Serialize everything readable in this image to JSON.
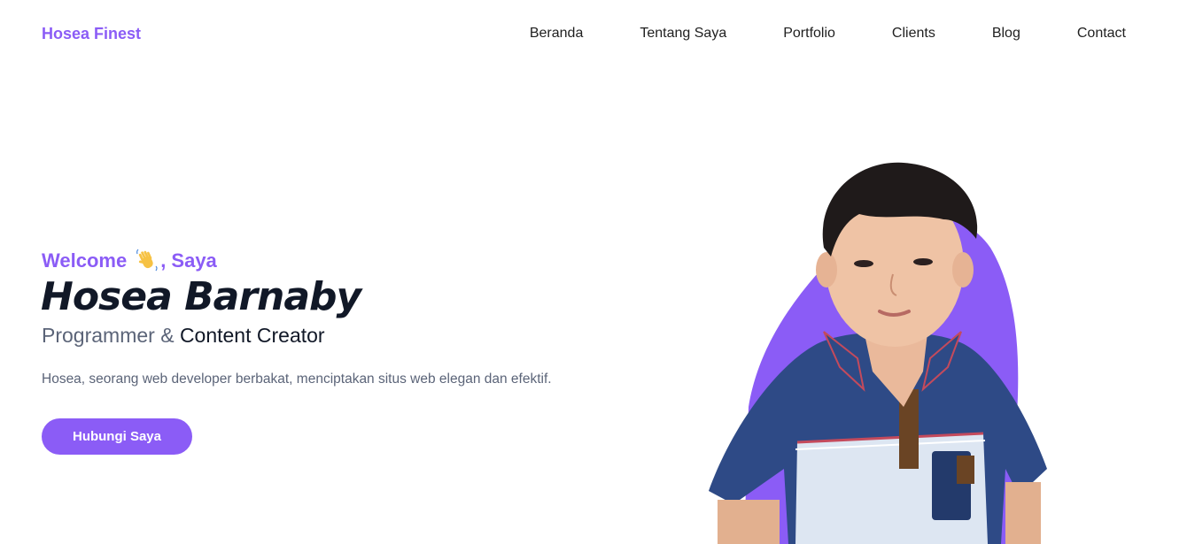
{
  "brand": {
    "name": "Hosea Finest"
  },
  "nav": {
    "items": [
      "Beranda",
      "Tentang Saya",
      "Portfolio",
      "Clients",
      "Blog",
      "Contact"
    ]
  },
  "hero": {
    "welcome_prefix": "Welcome",
    "welcome_suffix": ", Saya",
    "wave_icon": "waving-hand-icon",
    "name": "Hosea Barnaby",
    "role_part1": "Programmer",
    "role_amp": "&",
    "role_part2": "Content Creator",
    "description": "Hosea, seorang web developer berbakat, menciptakan situs web elegan dan efektif.",
    "cta_label": "Hubungi Saya"
  },
  "colors": {
    "accent": "#8b5cf6",
    "heading": "#111827",
    "muted": "#5b6478",
    "background": "#ffffff"
  }
}
